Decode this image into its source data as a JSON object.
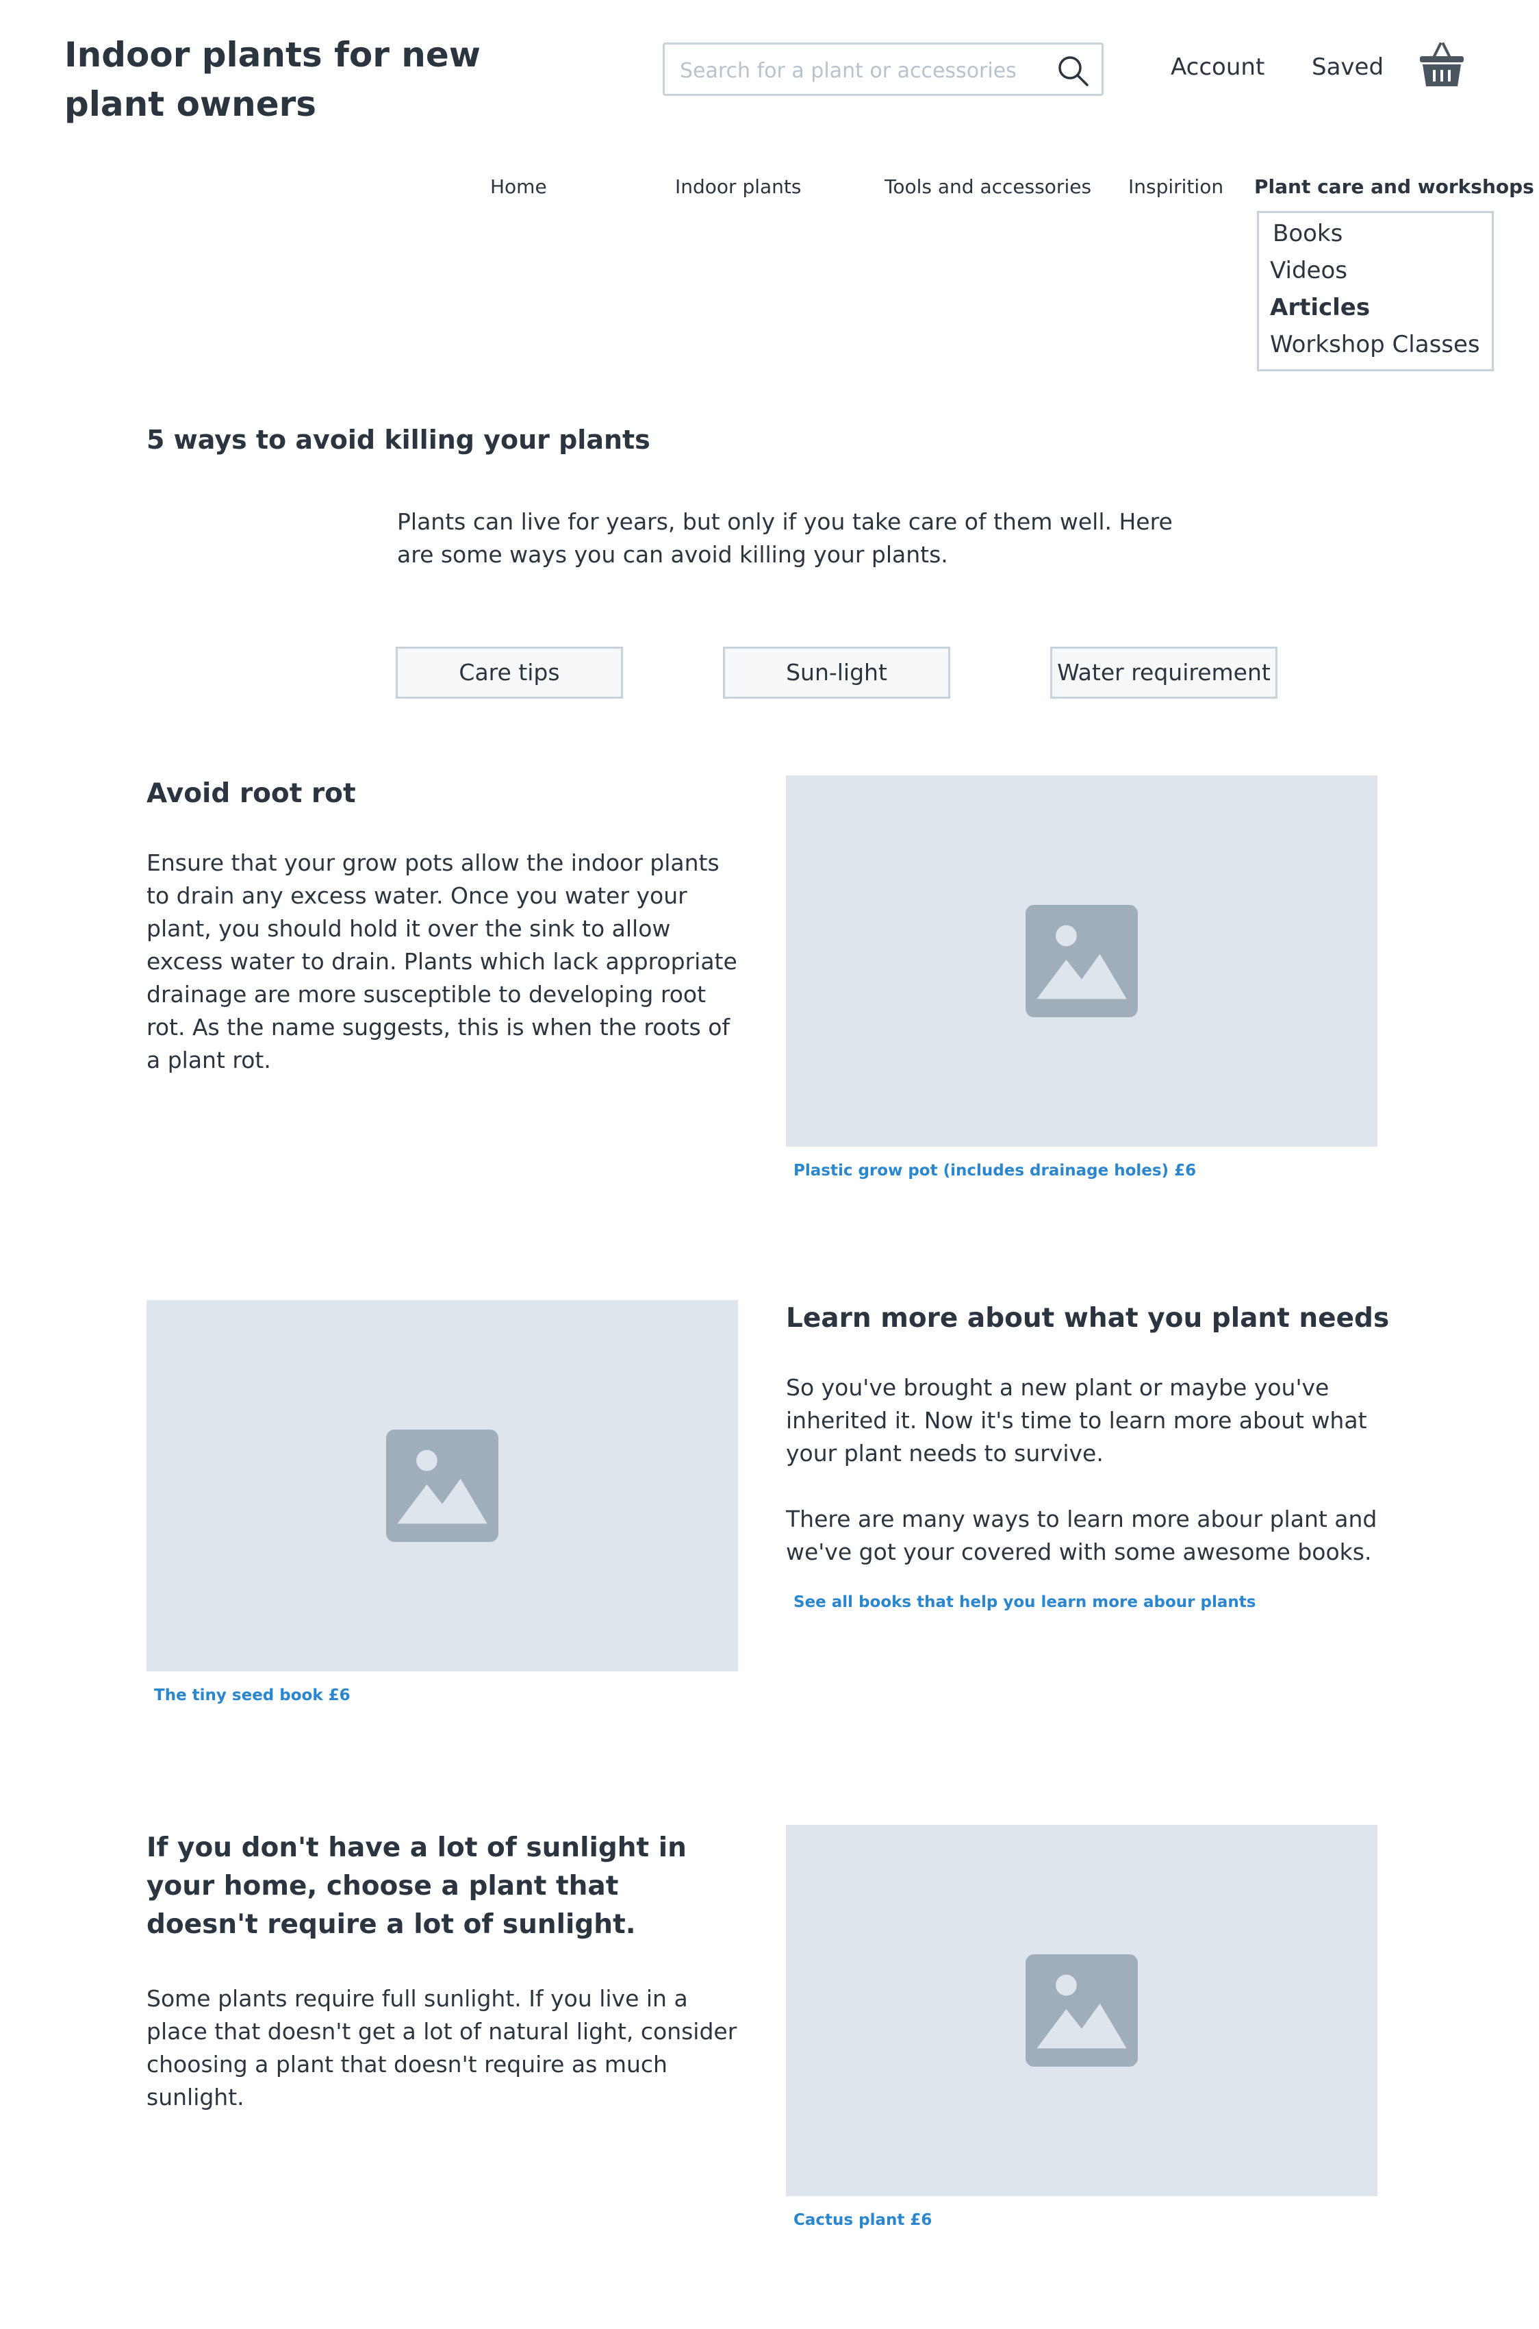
{
  "header": {
    "site_title": "Indoor plants for new plant owners",
    "search_placeholder": "Search for a plant or accessories",
    "account_label": "Account",
    "saved_label": "Saved",
    "basket_icon": "basket-icon",
    "search_icon": "search-icon"
  },
  "nav": {
    "items": [
      {
        "label": "Home"
      },
      {
        "label": "Indoor plants"
      },
      {
        "label": "Tools and accessories"
      },
      {
        "label": "Inspirition"
      },
      {
        "label": "Plant care and workshops",
        "active": true
      }
    ],
    "dropdown": [
      {
        "label": "Books"
      },
      {
        "label": "Videos"
      },
      {
        "label": "Articles",
        "active": true
      },
      {
        "label": "Workshop Classes"
      }
    ]
  },
  "article": {
    "title": "5 ways to avoid killing your plants",
    "intro": "Plants can live for years, but only if you take care of them well. Here are some ways you can avoid killing your plants.",
    "tags": [
      "Care tips",
      "Sun-light",
      "Water requirement"
    ]
  },
  "sections": [
    {
      "heading": "Avoid root rot",
      "paragraphs": [
        "Ensure that your grow pots allow the indoor plants to drain any excess water. Once you water your plant, you should hold it over the sink to allow excess water to drain. Plants which lack appropriate drainage are more susceptible to developing root rot. As the name suggests, this is when the roots of a plant rot."
      ],
      "caption": "Plastic grow pot (includes drainage holes) £6"
    },
    {
      "heading": "Learn more about what you plant needs",
      "paragraphs": [
        "So you've brought a new plant or maybe you've inherited it. Now it's time to learn more about what your plant needs to survive.",
        "There are many ways to learn more abour plant and we've got your covered with some awesome books."
      ],
      "link": "See all books that help you learn more abour plants",
      "caption": "The tiny seed book £6"
    },
    {
      "heading": "If you don't have a lot of sunlight in your home, choose a plant that doesn't require a lot of sunlight.",
      "paragraphs": [
        "Some plants require full sunlight. If you live in a place that doesn't get a lot of natural light, consider choosing a plant that doesn't require as much sunlight."
      ],
      "caption": "Cactus plant £6"
    }
  ],
  "image_icon": "image-placeholder-icon",
  "colors": {
    "text": "#2a3540",
    "border": "#c6d2dc",
    "placeholder_bg": "#dfe5ec",
    "icon": "#a0aeba",
    "link": "#2a86cf"
  }
}
